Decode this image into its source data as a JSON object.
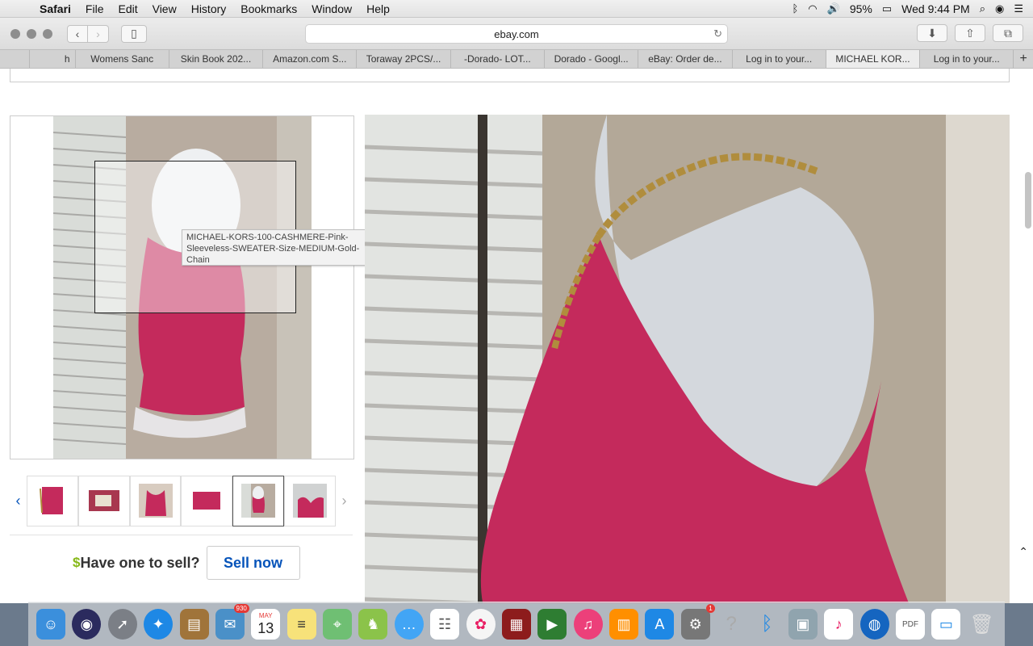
{
  "menubar": {
    "app": "Safari",
    "items": [
      "File",
      "Edit",
      "View",
      "History",
      "Bookmarks",
      "Window",
      "Help"
    ],
    "battery": "95%",
    "clock": "Wed 9:44 PM"
  },
  "toolbar": {
    "address": "ebay.com"
  },
  "tabs": [
    {
      "label": "h"
    },
    {
      "label": "Womens Sanc"
    },
    {
      "label": "Skin Book 202..."
    },
    {
      "label": "Amazon.com S..."
    },
    {
      "label": "Toraway 2PCS/..."
    },
    {
      "label": "-Dorado- LOT..."
    },
    {
      "label": "Dorado - Googl..."
    },
    {
      "label": "eBay: Order de..."
    },
    {
      "label": "Log in to your..."
    },
    {
      "label": "MICHAEL KOR..."
    },
    {
      "label": "Log in to your..."
    }
  ],
  "product": {
    "image_tooltip": "MICHAEL-KORS-100-CASHMERE-Pink-Sleeveless-SWEATER-Size-MEDIUM-Gold-Chain",
    "selected_thumb": 4
  },
  "sell": {
    "dollar": "$",
    "question": "Have one to sell?",
    "button": "Sell now"
  },
  "colors": {
    "ebay_link": "#0654ba",
    "sweater_pink": "#c42a5c",
    "dollar_green": "#86b817"
  },
  "dock": {
    "calendar_month": "MAY",
    "calendar_day": "13",
    "mail_badge": "930",
    "prefs_badge": "1"
  }
}
